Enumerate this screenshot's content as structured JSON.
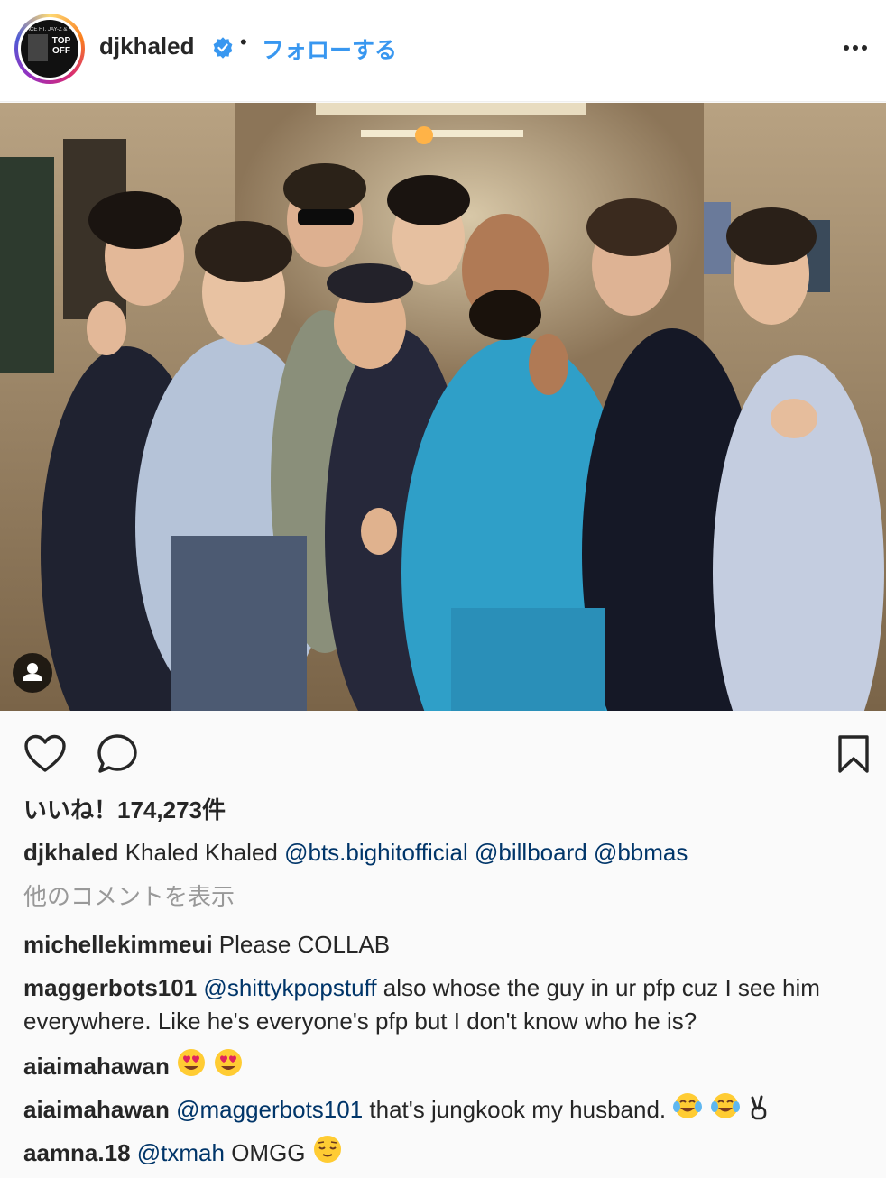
{
  "header": {
    "username": "djkhaled",
    "separator": "•",
    "follow_label": "フォローする",
    "avatar_text_top": "ACE FT. JAY-Z & FUTURE",
    "avatar_text_main": "TOP OFF"
  },
  "photo": {
    "alt": "Group photo in a backstage hallway"
  },
  "likes": {
    "label": "いいね！174,273件"
  },
  "caption": {
    "username": "djkhaled",
    "text": "Khaled Khaled",
    "mentions": [
      "@bts.bighitofficial",
      "@billboard",
      "@bbmas"
    ]
  },
  "view_comments_label": "他のコメントを表示",
  "comments": [
    {
      "username": "michellekimmeui",
      "text": "Please COLLAB"
    },
    {
      "username": "maggerbots101",
      "mention": "@shittykpopstuff",
      "text": "also whose the guy in ur pfp cuz I see him everywhere. Like he's everyone's pfp but I don't know who he is?"
    },
    {
      "username": "aiaimahawan",
      "text": ""
    },
    {
      "username": "aiaimahawan",
      "mention": "@maggerbots101",
      "text": "that's jungkook my husband."
    },
    {
      "username": "aamna.18",
      "mention": "@txmah",
      "text": "OMGG"
    }
  ],
  "colors": {
    "link": "#3897f0",
    "mention": "#003569",
    "muted": "#999999",
    "text": "#262626"
  },
  "icons": [
    "verified-badge-icon",
    "more-options-icon",
    "heart-icon",
    "comment-icon",
    "bookmark-icon",
    "user-tag-icon",
    "heart-eyes-emoji",
    "tears-of-joy-emoji",
    "victory-hand-emoji",
    "relieved-face-emoji"
  ]
}
